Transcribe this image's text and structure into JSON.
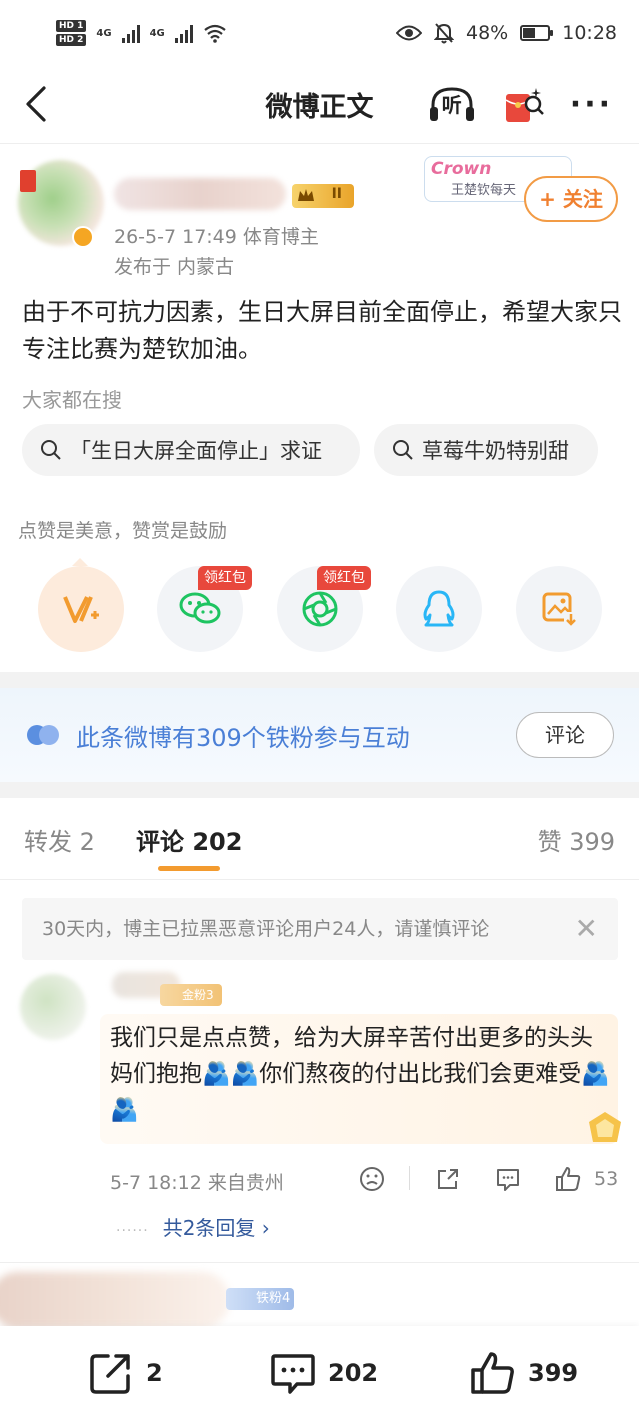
{
  "status_bar": {
    "sim1": "HD 1",
    "sim2": "HD 2",
    "network1": "4G",
    "network2": "4G",
    "battery": "48%",
    "battery_level": 0.48,
    "time": "10:28"
  },
  "nav": {
    "title": "微博正文",
    "listen_label": "听"
  },
  "post": {
    "level": "II",
    "crown_word": "Crown",
    "crown_sub": "王楚钦每天",
    "follow_label": "+ 关注",
    "meta": "26-5-7 17:49  体育博主",
    "location": "发布于 内蒙古",
    "text": "由于不可抗力因素，生日大屏目前全面停止，希望大家只专注比赛为楚钦加油。"
  },
  "search": {
    "label": "大家都在搜",
    "chips": [
      "「生日大屏全面停止」求证",
      "草莓牛奶特别甜"
    ]
  },
  "reward": {
    "tip": "点赞是美意，赞赏是鼓励",
    "red_tag": "领红包"
  },
  "fans": {
    "text": "此条微博有309个铁粉参与互动",
    "button": "评论"
  },
  "tabs": {
    "repost": "转发 2",
    "comment": "评论 202",
    "like": "赞 399"
  },
  "notice": {
    "text": "30天内，博主已拉黑恶意评论用户24人，请谨慎评论"
  },
  "comment": {
    "badge": "金粉3",
    "text": "我们只是点点赞，给为大屏辛苦付出更多的头头妈们抱抱🫂🫂你们熬夜的付出比我们会更难受🫂🫂",
    "time": "5-7 18:12  来自贵州",
    "likes": "53",
    "replies": "共2条回复 ›",
    "dots": "······"
  },
  "next_comment": {
    "badge": "铁粉4"
  },
  "bottom": {
    "repost": "2",
    "comment": "202",
    "like": "399"
  }
}
